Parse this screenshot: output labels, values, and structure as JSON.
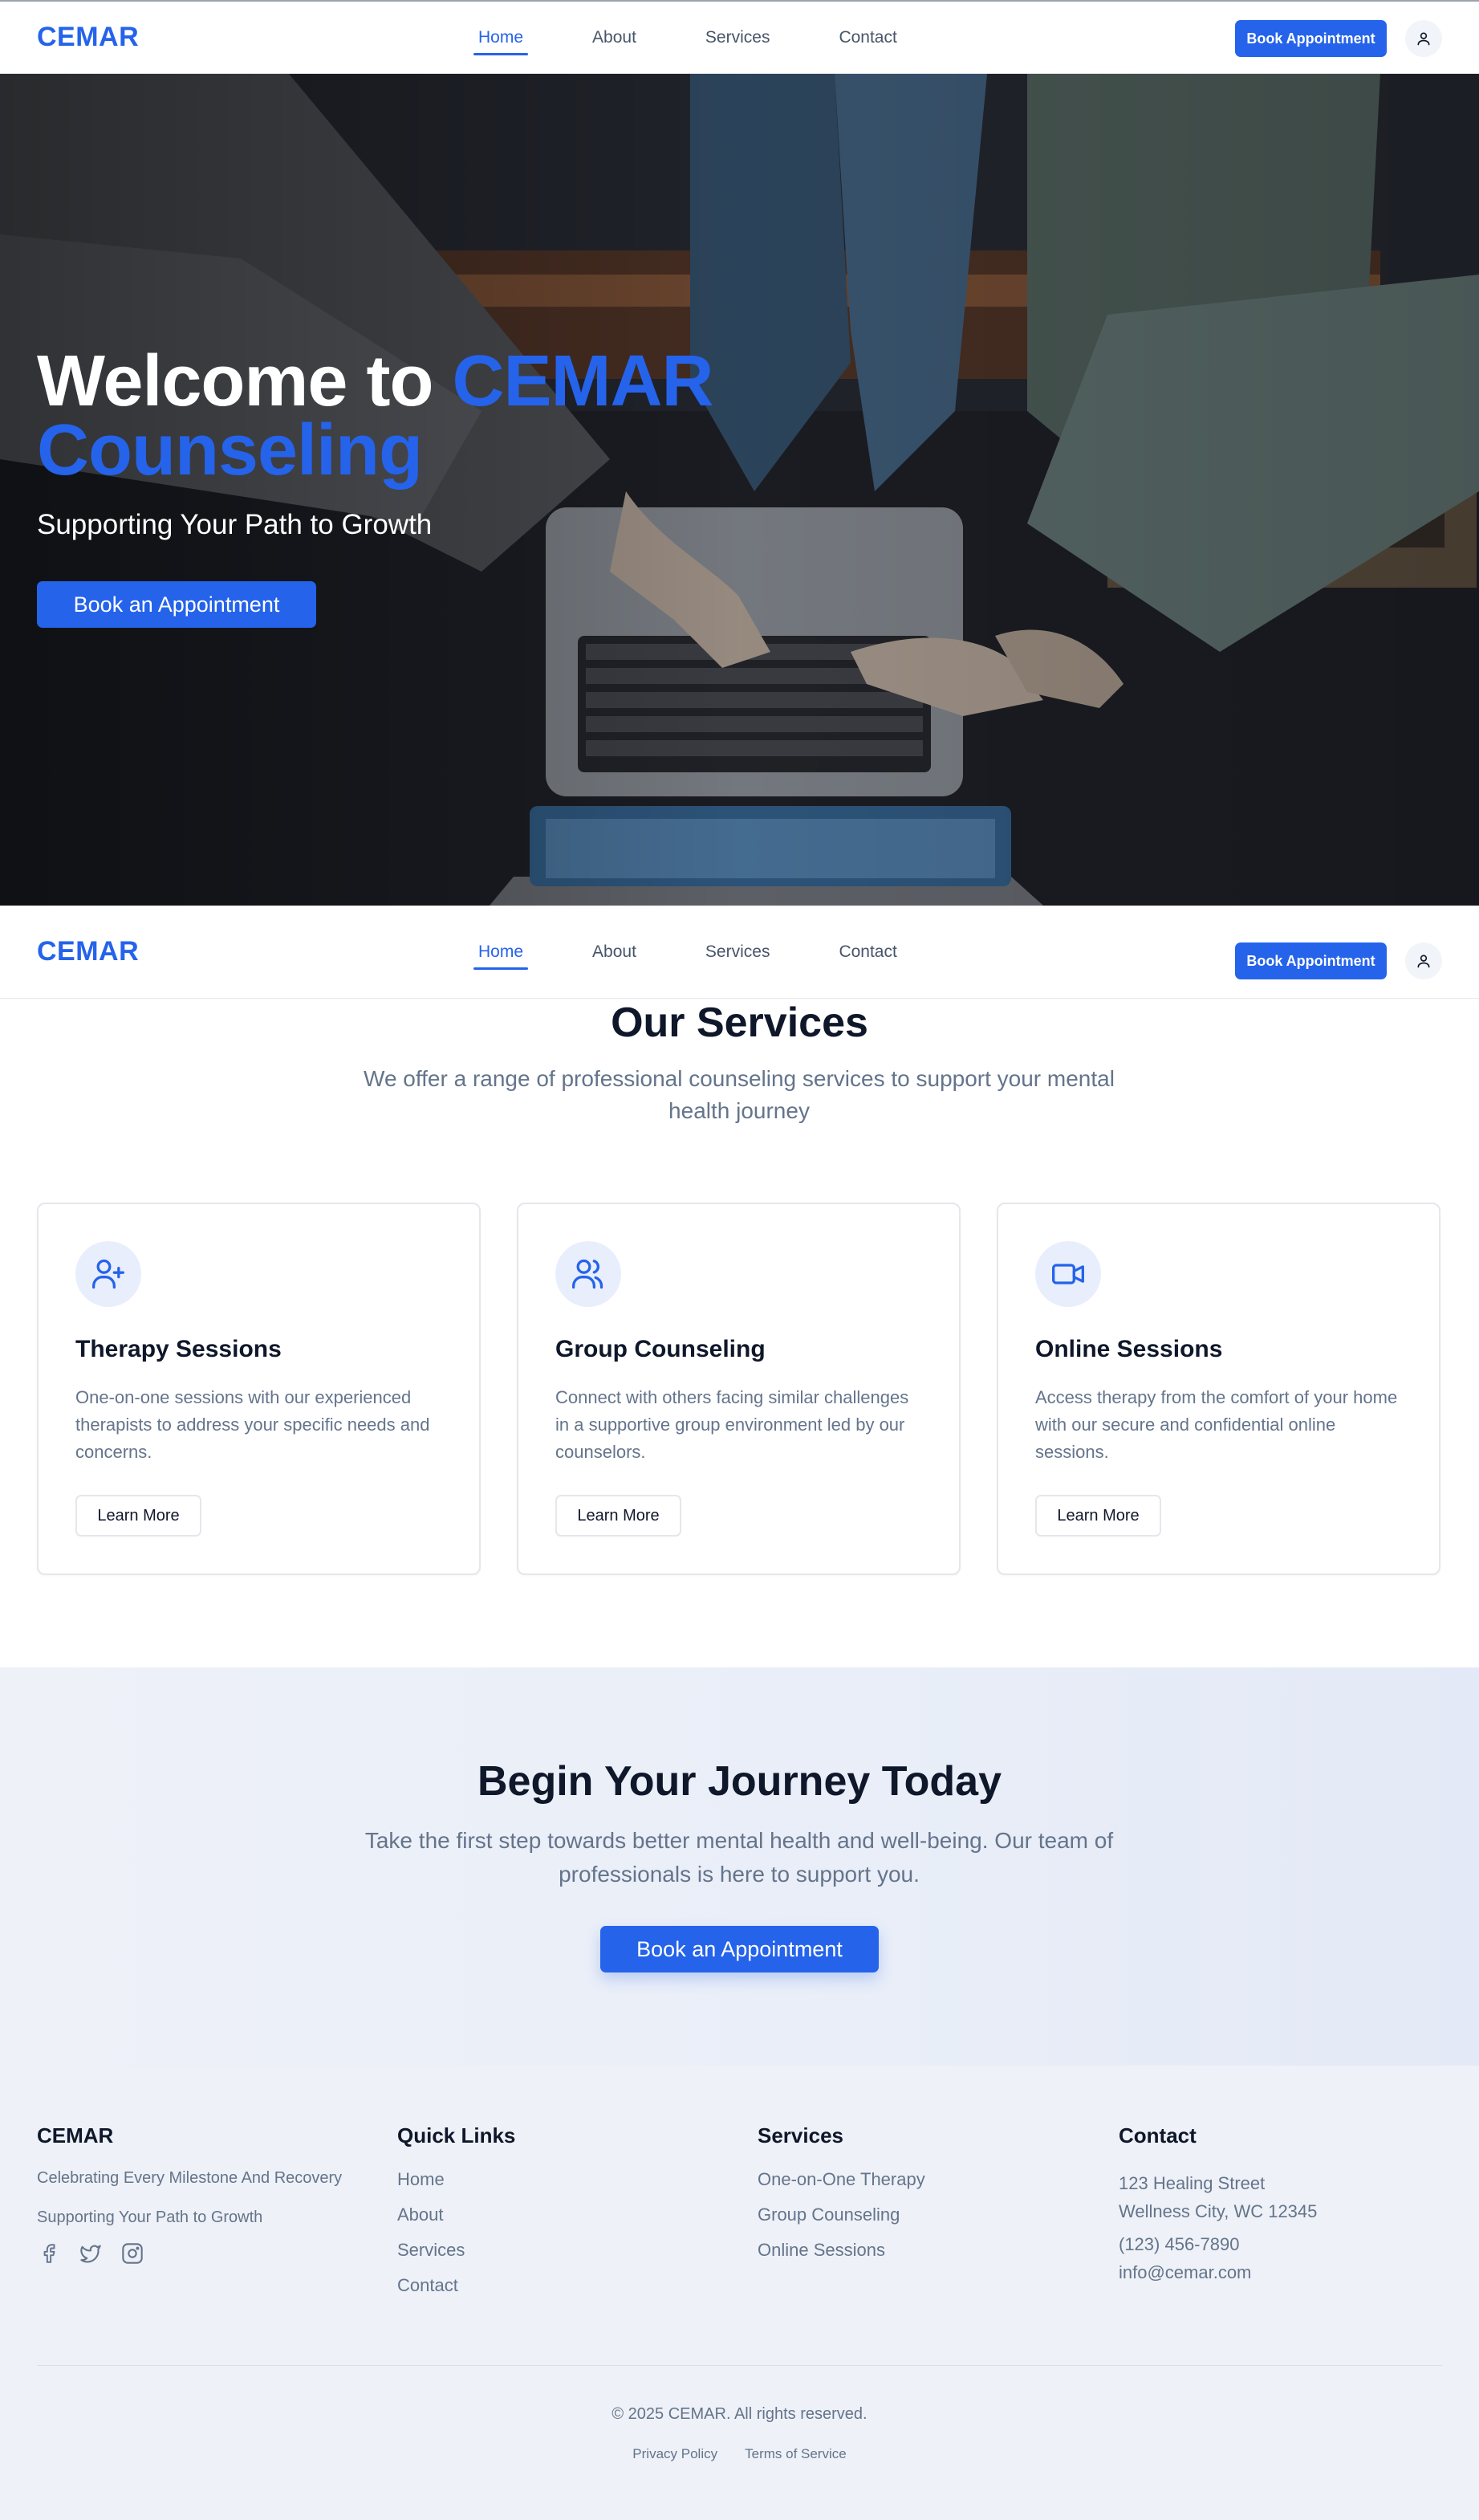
{
  "nav": {
    "logo": "CEMAR",
    "links": [
      "Home",
      "About",
      "Services",
      "Contact"
    ],
    "active": "Home",
    "book_label": "Book Appointment",
    "user_icon": "user-icon"
  },
  "hero": {
    "title_prefix": "Welcome to ",
    "title_brand": "CEMAR",
    "title_rest": "Counseling",
    "subtitle": "Supporting Your Path to Growth",
    "button": "Book an Appointment"
  },
  "services": {
    "title": "Our Services",
    "subtitle": "We offer a range of professional counseling services to support your mental health journey",
    "cards": [
      {
        "icon": "user-plus-icon",
        "title": "Therapy Sessions",
        "desc": "One-on-one sessions with our experienced therapists to address your specific needs and concerns.",
        "button": "Learn More"
      },
      {
        "icon": "users-icon",
        "title": "Group Counseling",
        "desc": "Connect with others facing similar challenges in a supportive group environment led by our counselors.",
        "button": "Learn More"
      },
      {
        "icon": "video-icon",
        "title": "Online Sessions",
        "desc": "Access therapy from the comfort of your home with our secure and confidential online sessions.",
        "button": "Learn More"
      }
    ]
  },
  "cta": {
    "title": "Begin Your Journey Today",
    "subtitle": "Take the first step towards better mental health and well-being. Our team of professionals is here to support you.",
    "button": "Book an Appointment"
  },
  "footer": {
    "brand": {
      "title": "CEMAR",
      "tagline1": "Celebrating Every Milestone And Recovery",
      "tagline2": "Supporting Your Path to Growth",
      "socials": [
        "facebook-icon",
        "twitter-icon",
        "instagram-icon"
      ]
    },
    "quick_links": {
      "title": "Quick Links",
      "items": [
        "Home",
        "About",
        "Services",
        "Contact"
      ]
    },
    "services": {
      "title": "Services",
      "items": [
        "One-on-One Therapy",
        "Group Counseling",
        "Online Sessions"
      ]
    },
    "contact": {
      "title": "Contact",
      "address1": "123 Healing Street",
      "address2": "Wellness City, WC 12345",
      "phone": "(123) 456-7890",
      "email": "info@cemar.com"
    },
    "copyright": "© 2025 CEMAR. All rights reserved.",
    "legal": [
      "Privacy Policy",
      "Terms of Service"
    ]
  },
  "colors": {
    "accent": "#2563eb",
    "text": "#0f172a",
    "muted": "#64748b"
  }
}
